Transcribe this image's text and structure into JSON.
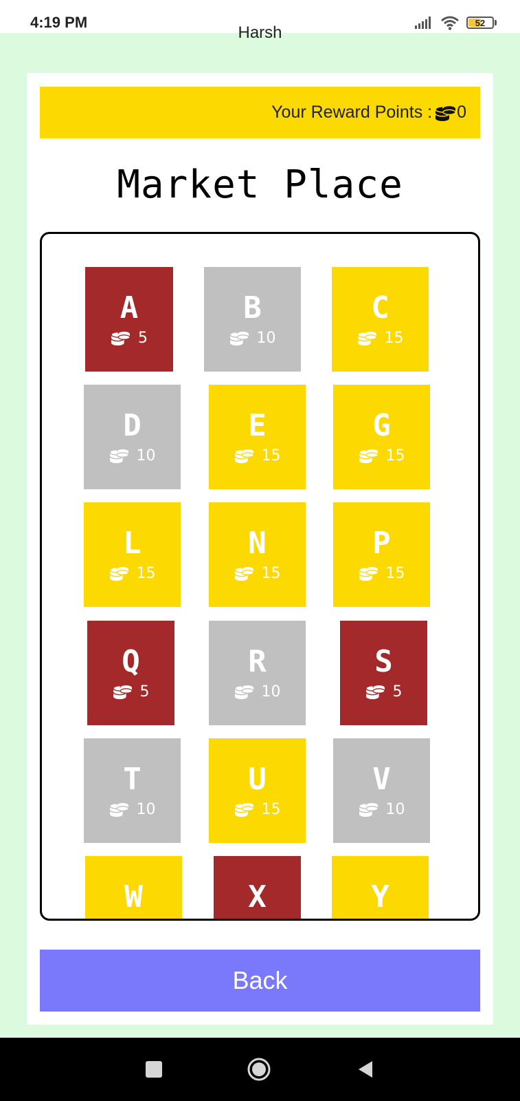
{
  "status_bar": {
    "time": "4:19 PM",
    "battery": "52",
    "icons": [
      "signal-icon",
      "wifi-icon",
      "battery-icon"
    ]
  },
  "header": {
    "user_name": "Harsh"
  },
  "reward": {
    "label": "Your Reward Points : ",
    "points": "0",
    "icon": "coins-icon"
  },
  "page_title": "Market Place",
  "colors": {
    "yellow": "#fcd900",
    "red": "#a3292b",
    "gray": "#c0c0c0",
    "back_button": "#7a78fb",
    "app_background": "#dcfbde"
  },
  "items": [
    {
      "letter": "A",
      "price": "5",
      "color": "red"
    },
    {
      "letter": "B",
      "price": "10",
      "color": "gray"
    },
    {
      "letter": "C",
      "price": "15",
      "color": "yellow"
    },
    {
      "letter": "D",
      "price": "10",
      "color": "gray"
    },
    {
      "letter": "E",
      "price": "15",
      "color": "yellow"
    },
    {
      "letter": "G",
      "price": "15",
      "color": "yellow"
    },
    {
      "letter": "L",
      "price": "15",
      "color": "yellow"
    },
    {
      "letter": "N",
      "price": "15",
      "color": "yellow"
    },
    {
      "letter": "P",
      "price": "15",
      "color": "yellow"
    },
    {
      "letter": "Q",
      "price": "5",
      "color": "red"
    },
    {
      "letter": "R",
      "price": "10",
      "color": "gray"
    },
    {
      "letter": "S",
      "price": "5",
      "color": "red"
    },
    {
      "letter": "T",
      "price": "10",
      "color": "gray"
    },
    {
      "letter": "U",
      "price": "15",
      "color": "yellow"
    },
    {
      "letter": "V",
      "price": "10",
      "color": "gray"
    },
    {
      "letter": "W",
      "price": "",
      "color": "yellow"
    },
    {
      "letter": "X",
      "price": "",
      "color": "red"
    },
    {
      "letter": "Y",
      "price": "",
      "color": "yellow"
    }
  ],
  "back_button": {
    "label": "Back"
  },
  "nav": {
    "icons": [
      "recent-apps-icon",
      "home-icon",
      "back-nav-icon"
    ]
  }
}
